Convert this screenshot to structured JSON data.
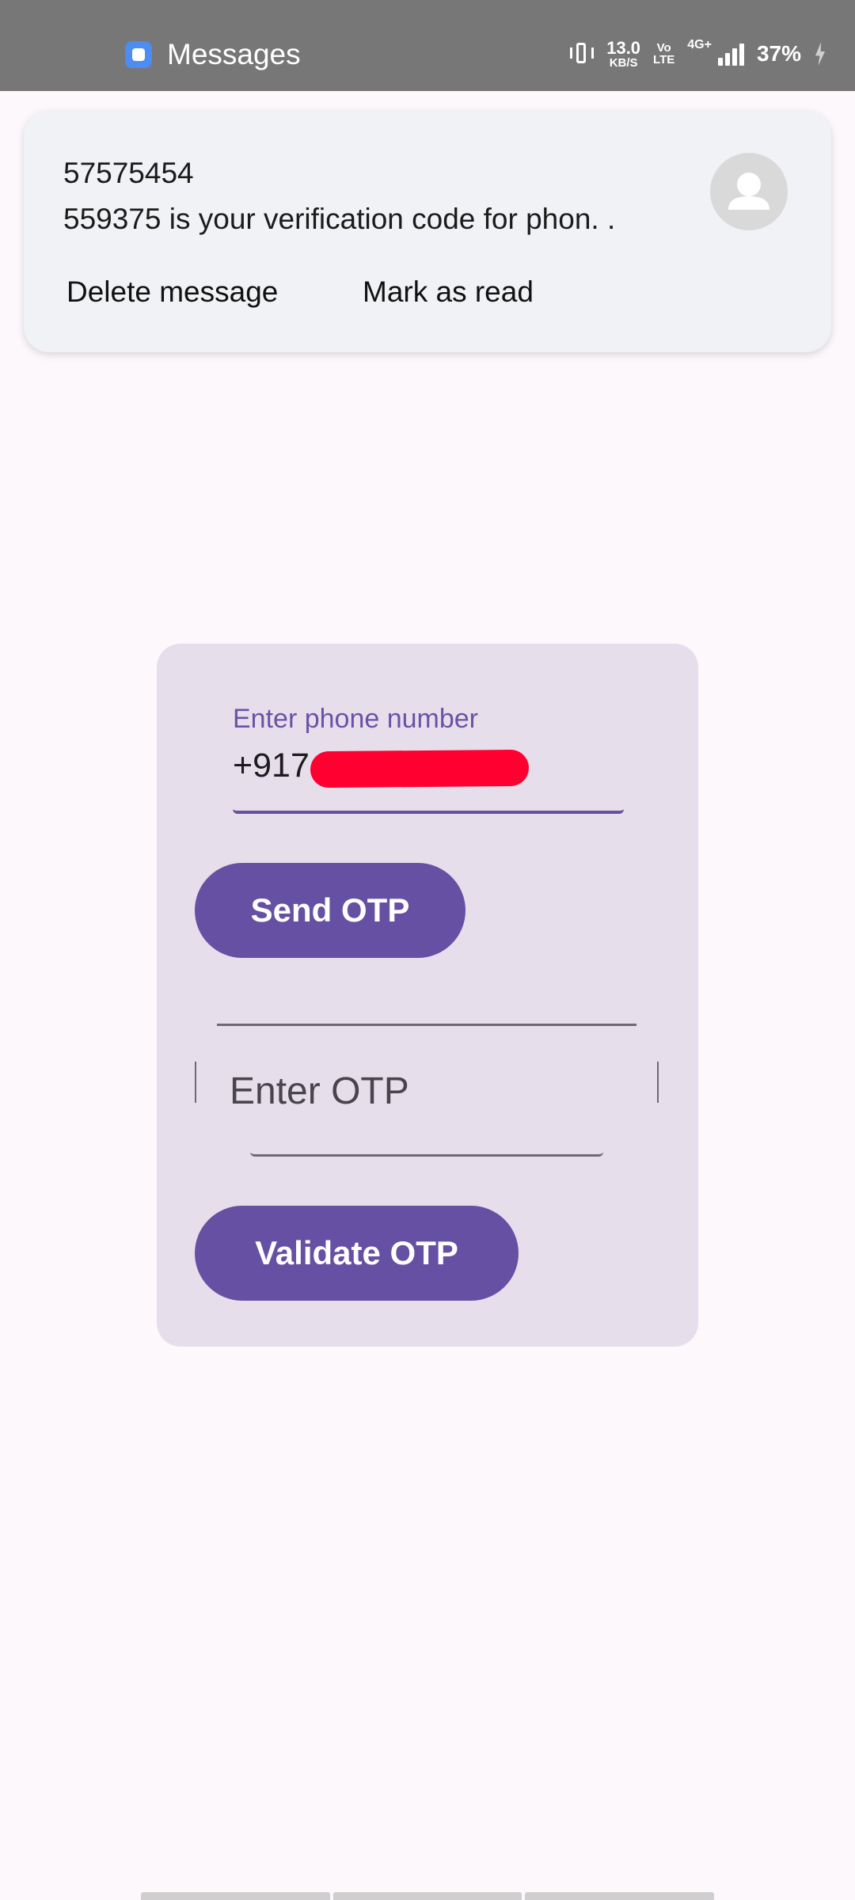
{
  "status_bar": {
    "app_name": "Messages",
    "net_speed_value": "13.0",
    "net_speed_unit": "KB/S",
    "volte_top": "Vo",
    "volte_bottom": "LTE",
    "network_type": "4G+",
    "battery": "37%",
    "icons": [
      "messages-app-icon",
      "vibrate-icon",
      "signal-icon",
      "charging-icon"
    ]
  },
  "notification": {
    "sender": "57575454",
    "body": "559375 is your verification code for phon. .",
    "actions": {
      "delete": "Delete message",
      "mark_read": "Mark as read"
    },
    "avatar_icon": "person-icon"
  },
  "form": {
    "phone_label": "Enter phone number",
    "phone_value": "+917",
    "send_button": "Send OTP",
    "otp_placeholder": "Enter OTP",
    "validate_button": "Validate OTP"
  },
  "colors": {
    "status_bar": "#777777",
    "page_background": "#fdf8fc",
    "card_background": "#e6dfeb",
    "accent": "#6650a4",
    "redaction": "#ff0030",
    "notification_background": "#f1f2f5"
  }
}
